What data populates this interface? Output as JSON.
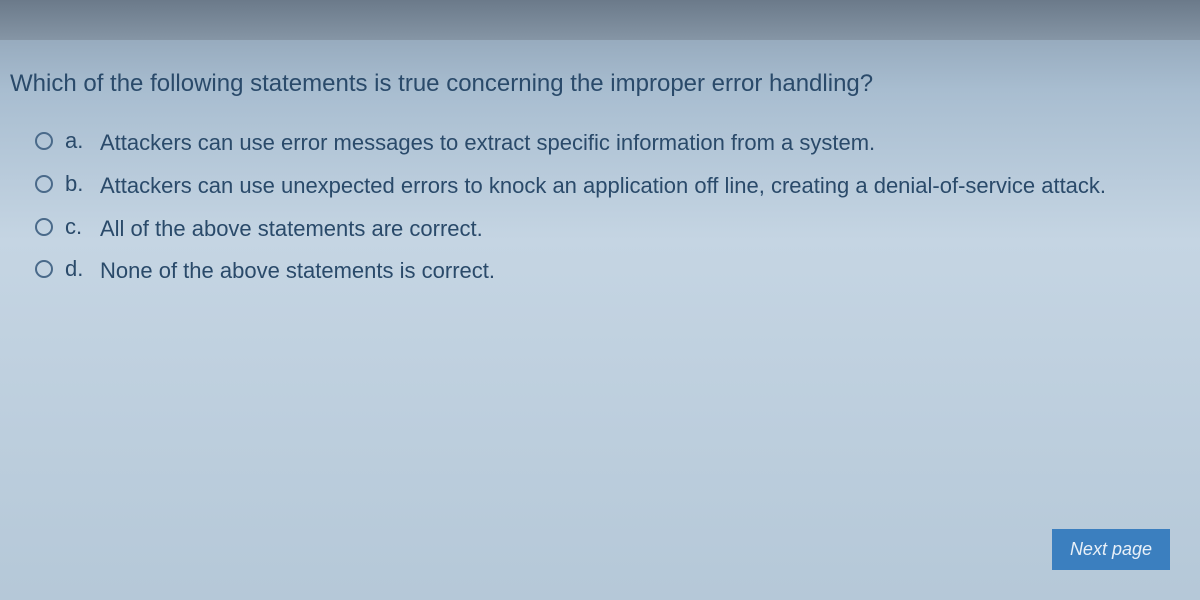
{
  "question": {
    "text": "Which of the following statements is true concerning the improper error handling?",
    "options": [
      {
        "letter": "a.",
        "text": "Attackers can use error messages to extract specific information from a system."
      },
      {
        "letter": "b.",
        "text": "Attackers can use unexpected errors to knock an application off line, creating a denial-of-service attack."
      },
      {
        "letter": "c.",
        "text": "All of the above statements are correct."
      },
      {
        "letter": "d.",
        "text": "None of the above statements is correct."
      }
    ]
  },
  "buttons": {
    "next": "Next page"
  }
}
